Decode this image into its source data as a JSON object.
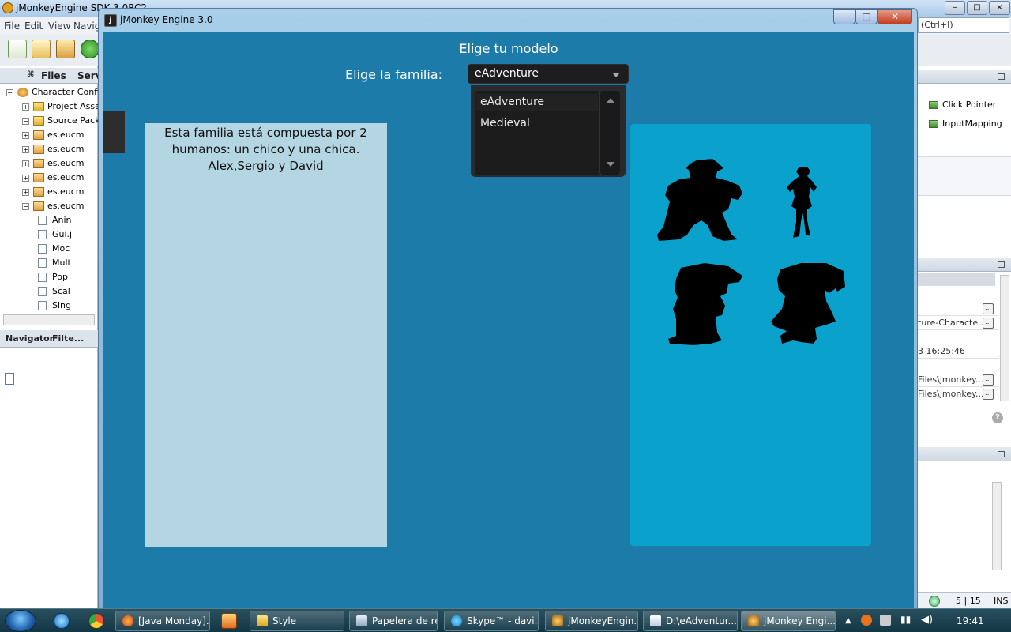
{
  "ide": {
    "title": "jMonkeyEngine SDK 3.0RC2",
    "menu": [
      "File",
      "Edit",
      "View",
      "Navig"
    ],
    "search_placeholder": "(Ctrl+I)",
    "left_tabs": [
      "Files",
      "Serv"
    ],
    "tree": [
      {
        "label": "Character Confi",
        "level": 0
      },
      {
        "label": "Project Asse",
        "level": 1
      },
      {
        "label": "Source Pack",
        "level": 1
      },
      {
        "label": "es.eucm",
        "level": 2
      },
      {
        "label": "es.eucm",
        "level": 2
      },
      {
        "label": "es.eucm",
        "level": 2
      },
      {
        "label": "es.eucm",
        "level": 2
      },
      {
        "label": "es.eucm",
        "level": 2
      },
      {
        "label": "es.eucm",
        "level": 2
      },
      {
        "label": "Anin",
        "level": 3
      },
      {
        "label": "Gui.j",
        "level": 3
      },
      {
        "label": "Moc",
        "level": 3
      },
      {
        "label": "Mult",
        "level": 3
      },
      {
        "label": "Pop",
        "level": 3
      },
      {
        "label": "Scal",
        "level": 3
      },
      {
        "label": "Sing",
        "level": 3
      }
    ],
    "nav_tabs": [
      "Navigator",
      "Filte..."
    ],
    "right_items": [
      "Click Pointer",
      "InputMapping"
    ],
    "props": [
      "ture-Characte...",
      "3 16:25:46",
      "Files\\jmonkey...",
      "Files\\jmonkey..."
    ],
    "status": {
      "pos": "5 | 15",
      "mode": "INS"
    }
  },
  "jme": {
    "window_title": "jMonkey Engine 3.0",
    "scene_title": "Elige tu modelo",
    "family_label": "Elige la familia:",
    "dropdown_value": "eAdventure",
    "dropdown_options": [
      "eAdventure",
      "Medieval"
    ],
    "description_lines": [
      "Esta familia está compuesta por 2",
      "humanos: un chico y una chica.",
      "Alex,Sergio y David"
    ]
  },
  "taskbar": {
    "tasks": [
      {
        "label": "[Java Monday]...",
        "icon": "firefox-icon"
      },
      {
        "label": "Style",
        "icon": "folder-icon"
      },
      {
        "label": "Papelera de re...",
        "icon": "recycle-bin-icon"
      },
      {
        "label": "Skype™ - davi...",
        "icon": "skype-icon"
      },
      {
        "label": "jMonkeyEngin...",
        "icon": "jmonkey-icon"
      },
      {
        "label": "D:\\eAdventur...",
        "icon": "notepad-icon"
      },
      {
        "label": "jMonkey Engi...",
        "icon": "jmonkey-icon"
      }
    ],
    "clock": "19:41"
  },
  "colors": {
    "canvas": "#1c7ba8",
    "desc_panel": "#b4d5e2",
    "preview_panel": "#0aa2cc",
    "dropdown": "#1d1d1f"
  }
}
